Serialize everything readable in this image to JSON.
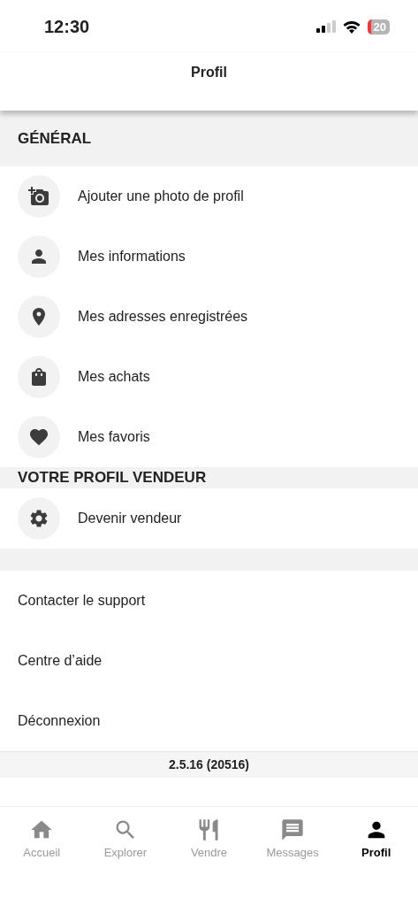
{
  "status_bar": {
    "time": "12:30",
    "battery": "20"
  },
  "header": {
    "title": "Profil"
  },
  "sections": [
    {
      "title": "GÉNÉRAL",
      "kind": "large",
      "items": [
        {
          "label": "Ajouter une photo de profil",
          "kind": "camera"
        },
        {
          "label": "Mes informations",
          "kind": "person"
        },
        {
          "label": "Mes adresses enregistrées",
          "kind": "pin"
        },
        {
          "label": "Mes achats",
          "kind": "bag"
        },
        {
          "label": "Mes favoris",
          "kind": "heart"
        }
      ]
    },
    {
      "title": "VOTRE PROFIL VENDEUR",
      "kind": "small",
      "items": [
        {
          "label": "Devenir vendeur",
          "kind": "gear"
        }
      ]
    }
  ],
  "links": [
    "Contacter le support",
    "Centre d’aide",
    "Déconnexion"
  ],
  "version": "2.5.16 (20516)",
  "tabs": [
    {
      "label": "Accueil",
      "kind": "home",
      "selected": false
    },
    {
      "label": "Explorer",
      "kind": "search",
      "selected": false
    },
    {
      "label": "Vendre",
      "kind": "fork",
      "selected": false
    },
    {
      "label": "Messages",
      "kind": "message",
      "selected": false
    },
    {
      "label": "Profil",
      "kind": "person",
      "selected": true
    }
  ]
}
